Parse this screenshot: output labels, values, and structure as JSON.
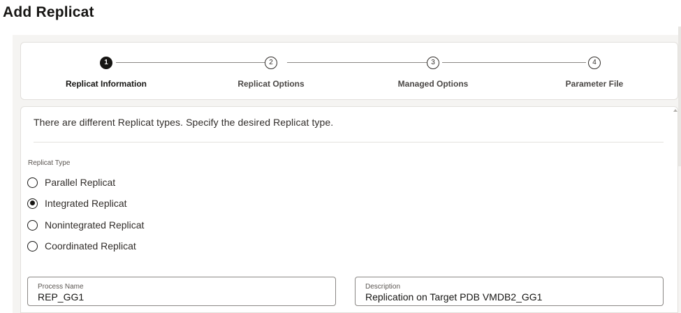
{
  "page": {
    "title": "Add Replicat"
  },
  "train": {
    "steps": [
      {
        "number": "1",
        "label": "Replicat Information",
        "state": "active"
      },
      {
        "number": "2",
        "label": "Replicat Options",
        "state": "pending"
      },
      {
        "number": "3",
        "label": "Managed Options",
        "state": "pending"
      },
      {
        "number": "4",
        "label": "Parameter File",
        "state": "pending"
      }
    ]
  },
  "form": {
    "intro_text": "There are different Replicat types. Specify the desired Replicat type.",
    "replicat_type": {
      "label": "Replicat Type",
      "options": [
        {
          "label": "Parallel Replicat",
          "selected": false
        },
        {
          "label": "Integrated Replicat",
          "selected": true
        },
        {
          "label": "Nonintegrated Replicat",
          "selected": false
        },
        {
          "label": "Coordinated Replicat",
          "selected": false
        }
      ]
    },
    "process_name": {
      "label": "Process Name",
      "value": "REP_GG1"
    },
    "description": {
      "label": "Description",
      "value": "Replication on Target PDB VMDB2_GG1"
    }
  }
}
